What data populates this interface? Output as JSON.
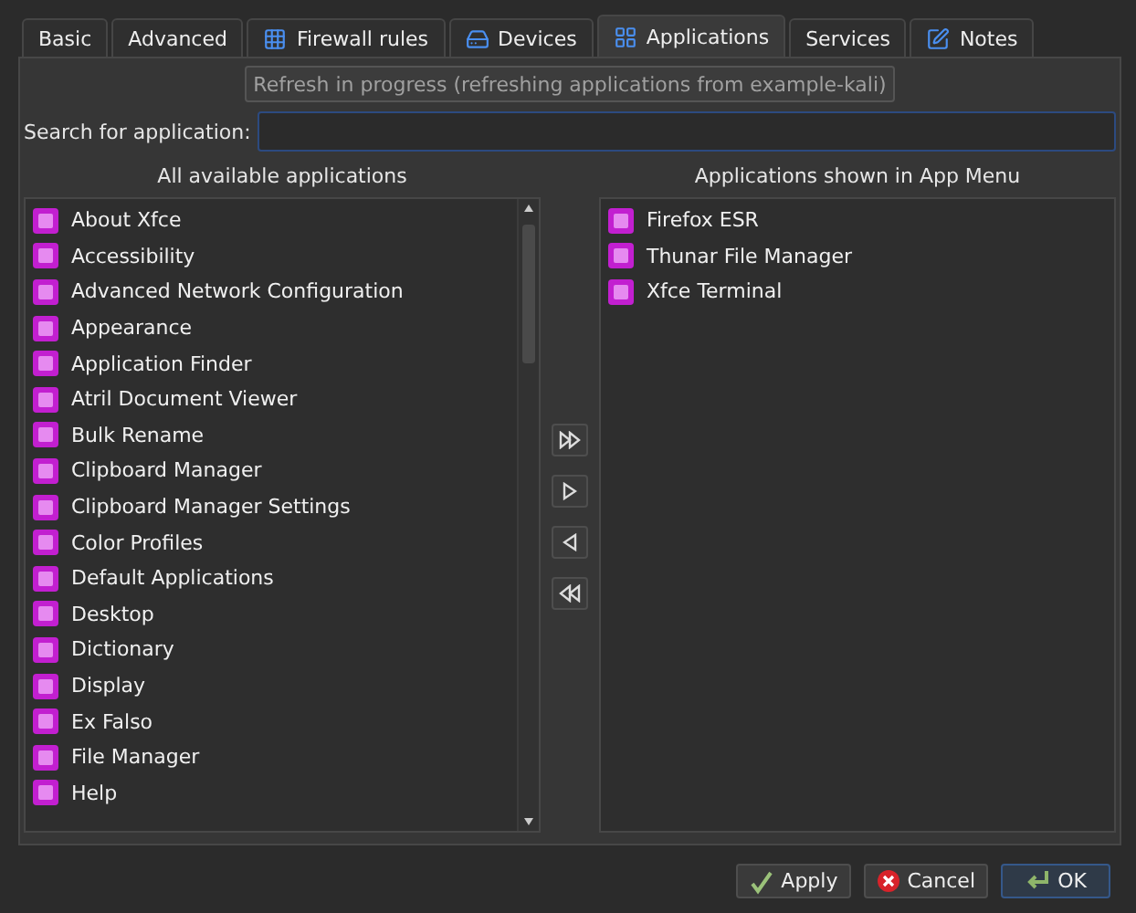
{
  "tabs": [
    {
      "label": "Basic",
      "selected": false
    },
    {
      "label": "Advanced",
      "selected": false
    },
    {
      "label": "Firewall rules",
      "selected": false,
      "kind": "grid"
    },
    {
      "label": "Devices",
      "selected": false,
      "kind": "drive"
    },
    {
      "label": "Applications",
      "selected": true,
      "kind": "apps"
    },
    {
      "label": "Services",
      "selected": false
    },
    {
      "label": "Notes",
      "selected": false,
      "kind": "note"
    }
  ],
  "refresh_button": {
    "label": "Refresh in progress (refreshing applications from example-kali)",
    "disabled": true
  },
  "search": {
    "label": "Search for application:"
  },
  "available": {
    "title": "All available applications",
    "items": [
      "About Xfce",
      "Accessibility",
      "Advanced Network Configuration",
      "Appearance",
      "Application Finder",
      "Atril Document Viewer",
      "Bulk Rename",
      "Clipboard Manager",
      "Clipboard Manager Settings",
      "Color Profiles",
      "Default Applications",
      "Desktop",
      "Dictionary",
      "Display",
      "Ex Falso",
      "File Manager",
      "Help"
    ]
  },
  "shown": {
    "title": "Applications shown in App Menu",
    "items": [
      "Firefox ESR",
      "Thunar File Manager",
      "Xfce Terminal"
    ]
  },
  "move_buttons": [
    {
      "kind": "add-all"
    },
    {
      "kind": "add"
    },
    {
      "kind": "remove"
    },
    {
      "kind": "remove-all"
    }
  ],
  "buttons": [
    {
      "label": "Apply",
      "kind": "apply"
    },
    {
      "label": "Cancel",
      "kind": "cancel"
    },
    {
      "label": "OK",
      "kind": "ok"
    }
  ]
}
